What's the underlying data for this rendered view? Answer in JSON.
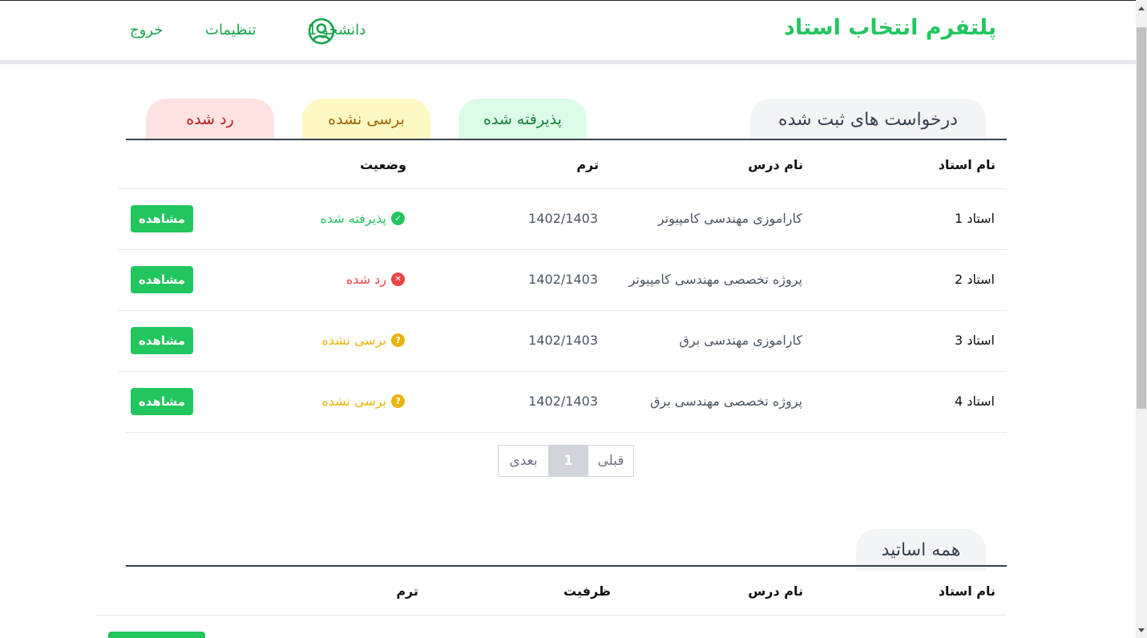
{
  "header": {
    "brand": "پلتفرم انتخاب استاد",
    "user_name": "دانشجو 1",
    "settings_label": "تنظیمات",
    "logout_label": "خروج",
    "user_icon": "user-circle-icon",
    "brand_color": "#22c55e"
  },
  "requests": {
    "section_title": "درخواست های ثبت شده",
    "filters": {
      "accepted": "پذیرفته شده",
      "pending": "برسی نشده",
      "rejected": "رد شده"
    },
    "columns": {
      "teacher": "نام استاد",
      "course": "نام درس",
      "term": "ترم",
      "status": "وضعیت"
    },
    "rows": [
      {
        "teacher": "استاد 1",
        "course": "کاراموزی مهندسی کامپیوتر",
        "term": "1402/1403",
        "status": "پذیرفته شده",
        "status_type": "accepted",
        "action": "مشاهده"
      },
      {
        "teacher": "استاد 2",
        "course": "پروژه تخصصی مهندسی کامپیوتر",
        "term": "1402/1403",
        "status": "رد شده",
        "status_type": "rejected",
        "action": "مشاهده"
      },
      {
        "teacher": "استاد 3",
        "course": "کاراموزی مهندسی برق",
        "term": "1402/1403",
        "status": "برسی نشده",
        "status_type": "pending",
        "action": "مشاهده"
      },
      {
        "teacher": "استاد 4",
        "course": "پروژه تخصصی مهندسی برق",
        "term": "1402/1403",
        "status": "برسی نشده",
        "status_type": "pending",
        "action": "مشاهده"
      }
    ],
    "pagination": {
      "prev": "قبلی",
      "current": "1",
      "next": "بعدی"
    }
  },
  "all_teachers": {
    "section_title": "همه اساتید",
    "columns": {
      "teacher": "نام استاد",
      "course": "نام درس",
      "capacity": "ظرفیت",
      "term": "ترم"
    }
  },
  "colors": {
    "accepted": "#22c55e",
    "rejected": "#ef4444",
    "pending": "#eab308"
  }
}
